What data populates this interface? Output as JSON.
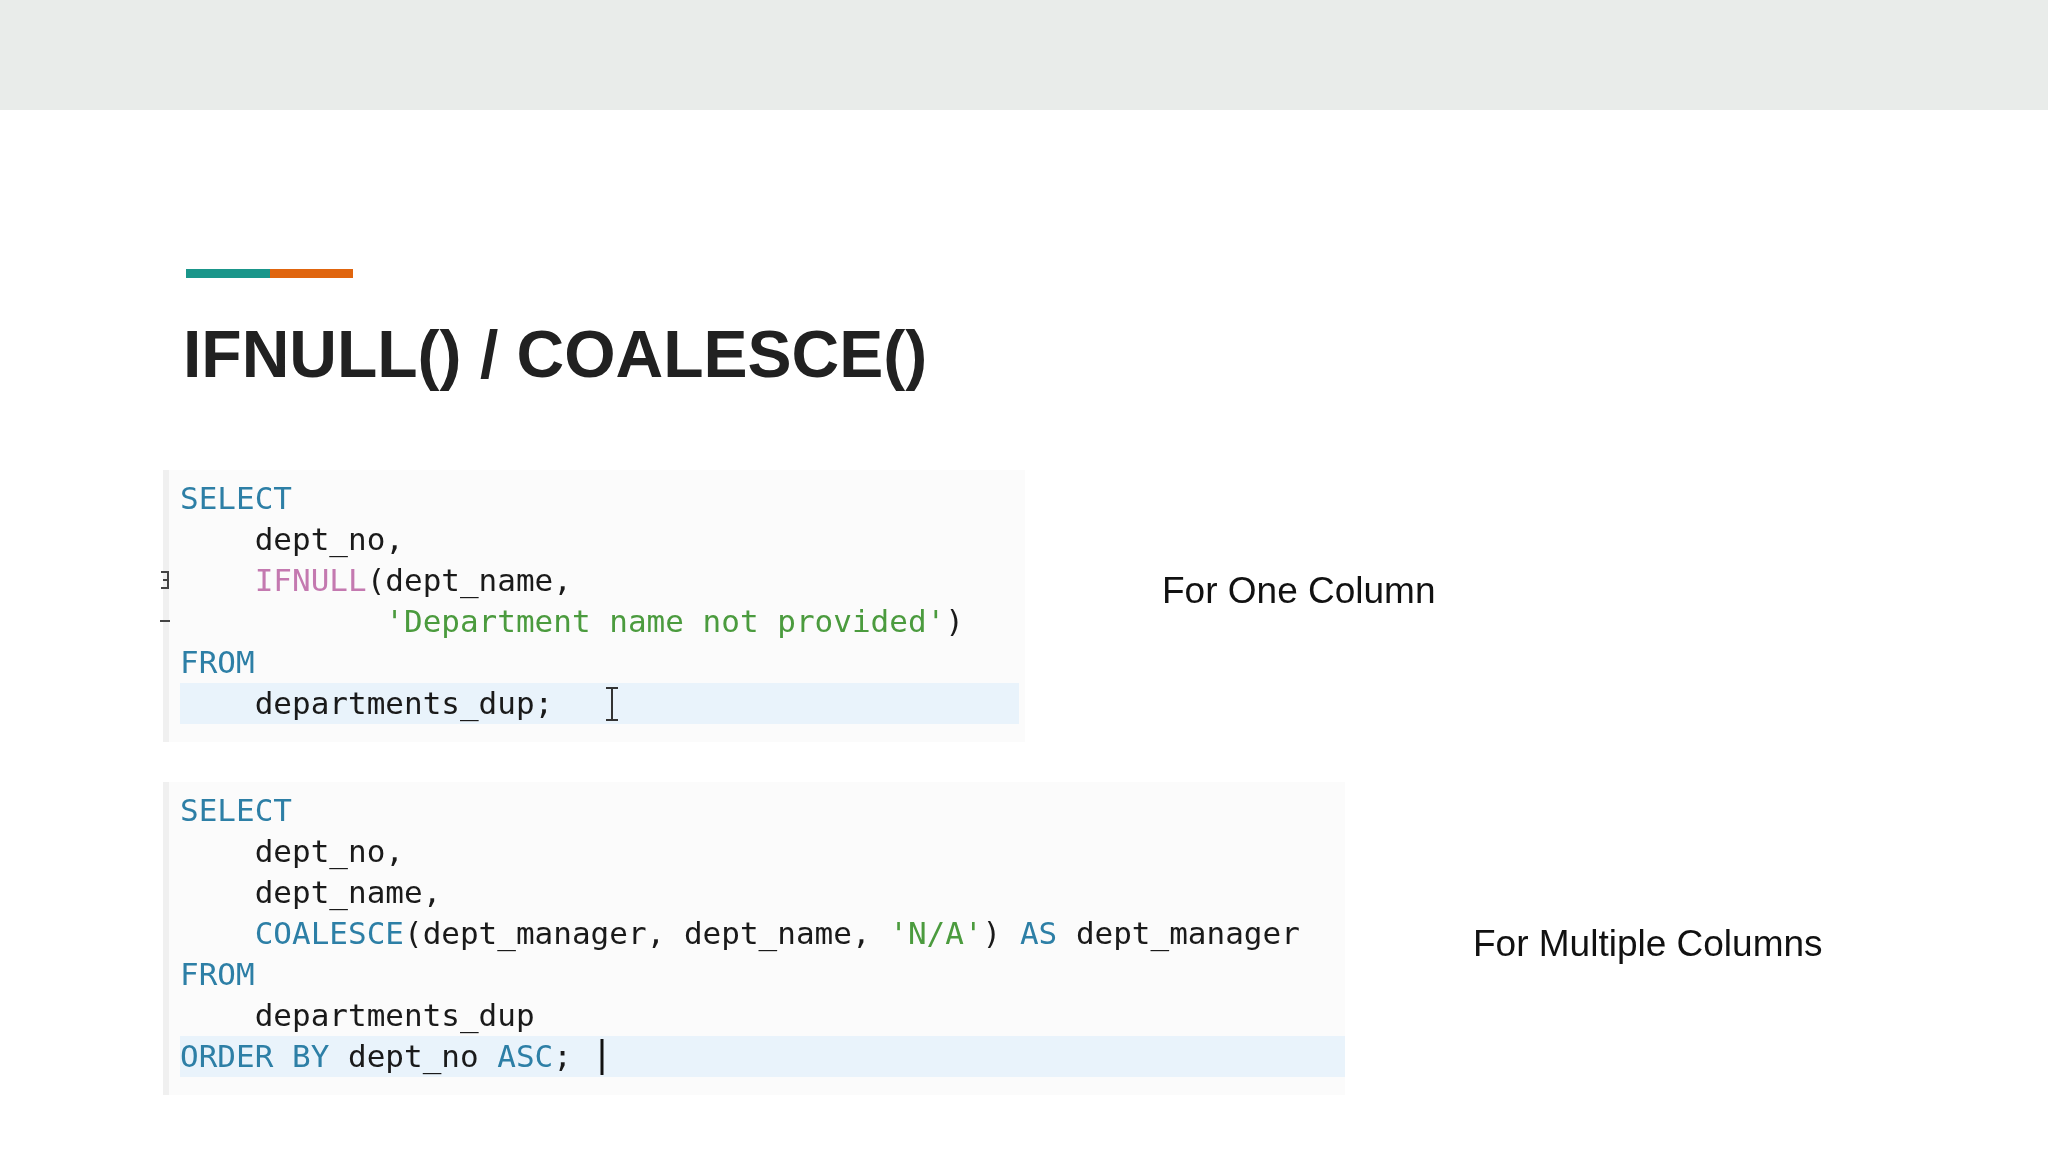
{
  "title": "IFNULL() / COALESCE()",
  "examples": [
    {
      "label": "For One Column",
      "lines": [
        {
          "tokens": [
            {
              "kind": "keyword",
              "text": "SELECT"
            }
          ],
          "highlighted": false,
          "fold_start": false,
          "fold_end": false,
          "mouse_pointer": false,
          "text_caret": false
        },
        {
          "tokens": [
            {
              "kind": "plain",
              "text": "    dept_no,"
            }
          ],
          "highlighted": false,
          "fold_start": false,
          "fold_end": false,
          "mouse_pointer": false,
          "text_caret": false
        },
        {
          "tokens": [
            {
              "kind": "function",
              "text": "    IFNULL"
            },
            {
              "kind": "plain",
              "text": "(dept_name,"
            }
          ],
          "highlighted": false,
          "fold_start": true,
          "fold_end": false,
          "mouse_pointer": false,
          "text_caret": false
        },
        {
          "tokens": [
            {
              "kind": "string",
              "text": "           'Department name not provided'"
            },
            {
              "kind": "plain",
              "text": ")"
            }
          ],
          "highlighted": false,
          "fold_start": false,
          "fold_end": true,
          "mouse_pointer": false,
          "text_caret": false
        },
        {
          "tokens": [
            {
              "kind": "keyword",
              "text": "FROM"
            }
          ],
          "highlighted": false,
          "fold_start": false,
          "fold_end": false,
          "mouse_pointer": false,
          "text_caret": false
        },
        {
          "tokens": [
            {
              "kind": "plain",
              "text": "    departments_dup;"
            }
          ],
          "highlighted": true,
          "fold_start": false,
          "fold_end": false,
          "mouse_pointer": true,
          "text_caret": false
        }
      ]
    },
    {
      "label": "For Multiple Columns",
      "lines": [
        {
          "tokens": [
            {
              "kind": "keyword",
              "text": "SELECT"
            }
          ],
          "highlighted": false,
          "fold_start": false,
          "fold_end": false,
          "mouse_pointer": false,
          "text_caret": false
        },
        {
          "tokens": [
            {
              "kind": "plain",
              "text": "    dept_no,"
            }
          ],
          "highlighted": false,
          "fold_start": false,
          "fold_end": false,
          "mouse_pointer": false,
          "text_caret": false
        },
        {
          "tokens": [
            {
              "kind": "plain",
              "text": "    dept_name,"
            }
          ],
          "highlighted": false,
          "fold_start": false,
          "fold_end": false,
          "mouse_pointer": false,
          "text_caret": false
        },
        {
          "tokens": [
            {
              "kind": "keyword",
              "text": "    COALESCE"
            },
            {
              "kind": "plain",
              "text": "(dept_manager, dept_name, "
            },
            {
              "kind": "string",
              "text": "'N/A'"
            },
            {
              "kind": "plain",
              "text": ") "
            },
            {
              "kind": "keyword",
              "text": "AS"
            },
            {
              "kind": "plain",
              "text": " dept_manager"
            }
          ],
          "highlighted": false,
          "fold_start": false,
          "fold_end": false,
          "mouse_pointer": false,
          "text_caret": false
        },
        {
          "tokens": [
            {
              "kind": "keyword",
              "text": "FROM"
            }
          ],
          "highlighted": false,
          "fold_start": false,
          "fold_end": false,
          "mouse_pointer": false,
          "text_caret": false
        },
        {
          "tokens": [
            {
              "kind": "plain",
              "text": "    departments_dup"
            }
          ],
          "highlighted": false,
          "fold_start": false,
          "fold_end": false,
          "mouse_pointer": false,
          "text_caret": false
        },
        {
          "tokens": [
            {
              "kind": "keyword",
              "text": "ORDER BY"
            },
            {
              "kind": "plain",
              "text": " dept_no "
            },
            {
              "kind": "keyword",
              "text": "ASC"
            },
            {
              "kind": "plain",
              "text": ";"
            }
          ],
          "highlighted": true,
          "fold_start": false,
          "fold_end": false,
          "mouse_pointer": false,
          "text_caret": true
        }
      ]
    }
  ]
}
